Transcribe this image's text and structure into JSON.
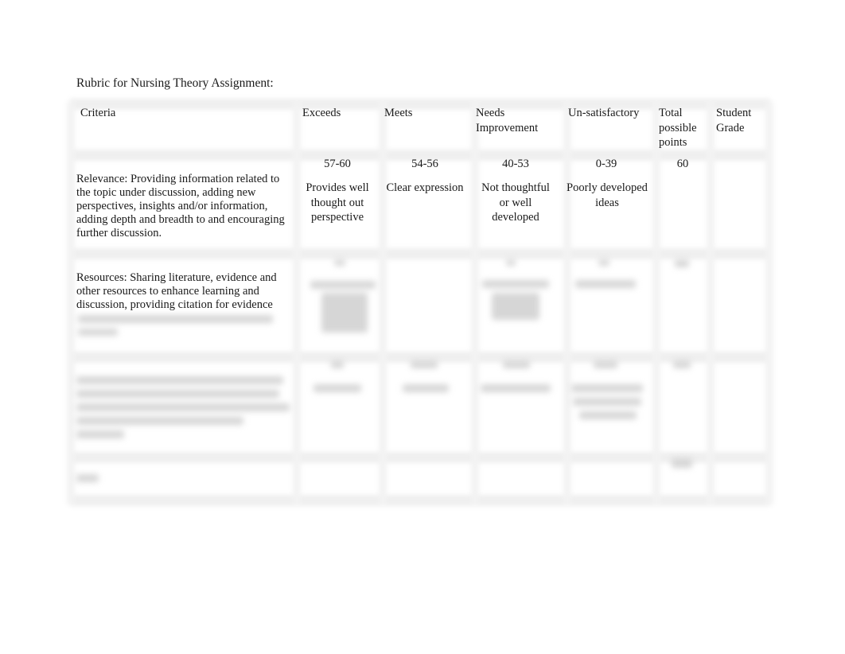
{
  "document": {
    "title": "Rubric for Nursing Theory Assignment:"
  },
  "table": {
    "headers": {
      "criteria": "Criteria",
      "exceeds": "Exceeds",
      "meets": "Meets",
      "needs_improvement": "Needs Improvement",
      "unsatisfactory": "Un-satisfactory",
      "total_possible_points": "Total possible points",
      "student_grade": "Student Grade"
    },
    "rows": [
      {
        "criterion": "Relevance:  Providing information related to the topic under discussion, adding new perspectives, insights and/or information, adding depth and breadth to and encouraging further discussion.",
        "exceeds_range": "57-60",
        "meets_range": "54-56",
        "needs_improvement_range": "40-53",
        "unsatisfactory_range": "0-39",
        "total_points": "60",
        "exceeds_desc": "Provides well thought out perspective",
        "meets_desc": "Clear expression",
        "needs_improvement_desc": "Not thoughtful or well developed",
        "unsatisfactory_desc": "Poorly developed ideas",
        "student_grade": ""
      },
      {
        "criterion": "Resources:  Sharing literature, evidence and other resources to enhance learning and discussion, providing citation for evidence",
        "blurred": true
      },
      {
        "criterion": "",
        "blurred": true
      },
      {
        "criterion": "",
        "blurred": true,
        "is_total_row": true
      }
    ]
  }
}
